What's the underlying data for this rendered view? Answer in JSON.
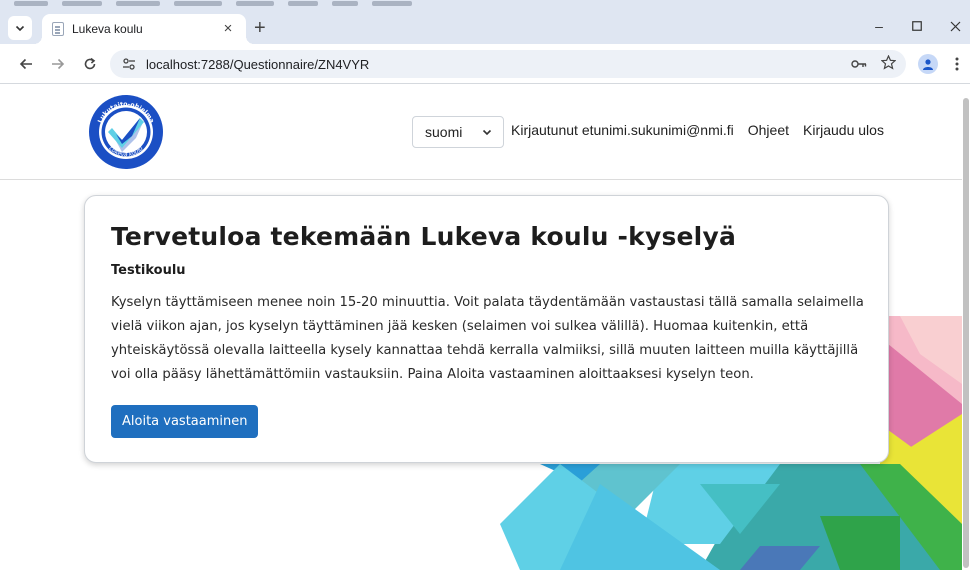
{
  "browser": {
    "tab_title": "Lukeva koulu",
    "tab_close": "×",
    "new_tab": "+",
    "url": "localhost:7288/Questionnaire/ZN4VYR",
    "window_controls": {
      "minimize": "–",
      "maximize": "☐",
      "close": "✕"
    },
    "icons": [
      "tab-search-icon",
      "favicon-icon",
      "back-icon",
      "forward-icon",
      "reload-icon",
      "site-info-icon",
      "password-key-icon",
      "bookmark-star-icon",
      "profile-icon",
      "menu-dots-icon"
    ]
  },
  "header": {
    "logo_text_top": "Lukutaito-ohjelma",
    "logo_text_bottom": "Lukeva koulu",
    "language_selected": "suomi",
    "logged_in_text": "Kirjautunut etunimi.sukunimi@nmi.fi",
    "help_link": "Ohjeet",
    "logout_link": "Kirjaudu ulos"
  },
  "card": {
    "title": "Tervetuloa tekemään Lukeva koulu -kyselyä",
    "school": "Testikoulu",
    "intro": "Kyselyn täyttämiseen menee noin 15-20 minuuttia. Voit palata täydentämään vastaustasi tällä samalla selaimella vielä viikon ajan, jos kyselyn täyttäminen jää kesken (selaimen voi sulkea välillä). Huomaa kuitenkin, että yhteiskäytössä olevalla laitteella kysely kannattaa tehdä kerralla valmiiksi, sillä muuten laitteen muilla käyttäjillä voi olla pääsy lähettämättömiin vastauksiin. Paina Aloita vastaaminen aloittaaksesi kyselyn teon.",
    "start_button": "Aloita vastaaminen"
  },
  "colors": {
    "primary_button": "#1f6fbf",
    "logo_blue": "#1b4fc4",
    "deco_cyan": "#5fd0e6",
    "deco_teal": "#3aa9a9",
    "deco_green": "#3fb24a",
    "deco_pink": "#e07aa8",
    "deco_yellow": "#e9e437"
  }
}
